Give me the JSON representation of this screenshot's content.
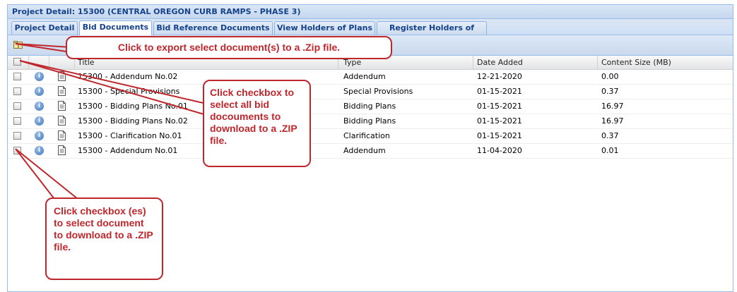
{
  "panel": {
    "title": "Project Detail: 15300 (CENTRAL OREGON CURB RAMPS - PHASE 3)"
  },
  "tabs": [
    {
      "label": "Project Detail",
      "active": false
    },
    {
      "label": "Bid Documents",
      "active": true
    },
    {
      "label": "Bid Reference Documents",
      "active": false
    },
    {
      "label": "View Holders of Plans",
      "active": false
    },
    {
      "label": "Register Holders of Plans",
      "active": false
    }
  ],
  "toolbar": {
    "export_icon": "zip-folder-icon"
  },
  "grid": {
    "columns": {
      "title": "Title",
      "type": "Type",
      "date_added": "Date Added",
      "content_size": "Content Size (MB)"
    },
    "rows": [
      {
        "title": "15300 - Addendum No.02",
        "type": "Addendum",
        "date": "12-21-2020",
        "size": "0.00"
      },
      {
        "title": "15300 - Special Provisions",
        "type": "Special Provisions",
        "date": "01-15-2021",
        "size": "0.37"
      },
      {
        "title": "15300 - Bidding Plans No.01",
        "type": "Bidding Plans",
        "date": "01-15-2021",
        "size": "16.97"
      },
      {
        "title": "15300 - Bidding Plans No.02",
        "type": "Bidding Plans",
        "date": "01-15-2021",
        "size": "16.97"
      },
      {
        "title": "15300 - Clarification No.01",
        "type": "Clarification",
        "date": "01-15-2021",
        "size": "0.37"
      },
      {
        "title": "15300 - Addendum No.01",
        "type": "Addendum",
        "date": "11-04-2020",
        "size": "0.01"
      }
    ]
  },
  "callouts": {
    "export": "Click to export select document(s) to a .Zip file.",
    "select_all": "Click checkbox to select all bid docouments to download to a .ZIP file.",
    "select_rows": "Click checkbox (es) to select document to download to a .ZIP file."
  },
  "colors": {
    "callout": "#c0272d",
    "header_text": "#15428b",
    "panel_border": "#99bbe8"
  }
}
